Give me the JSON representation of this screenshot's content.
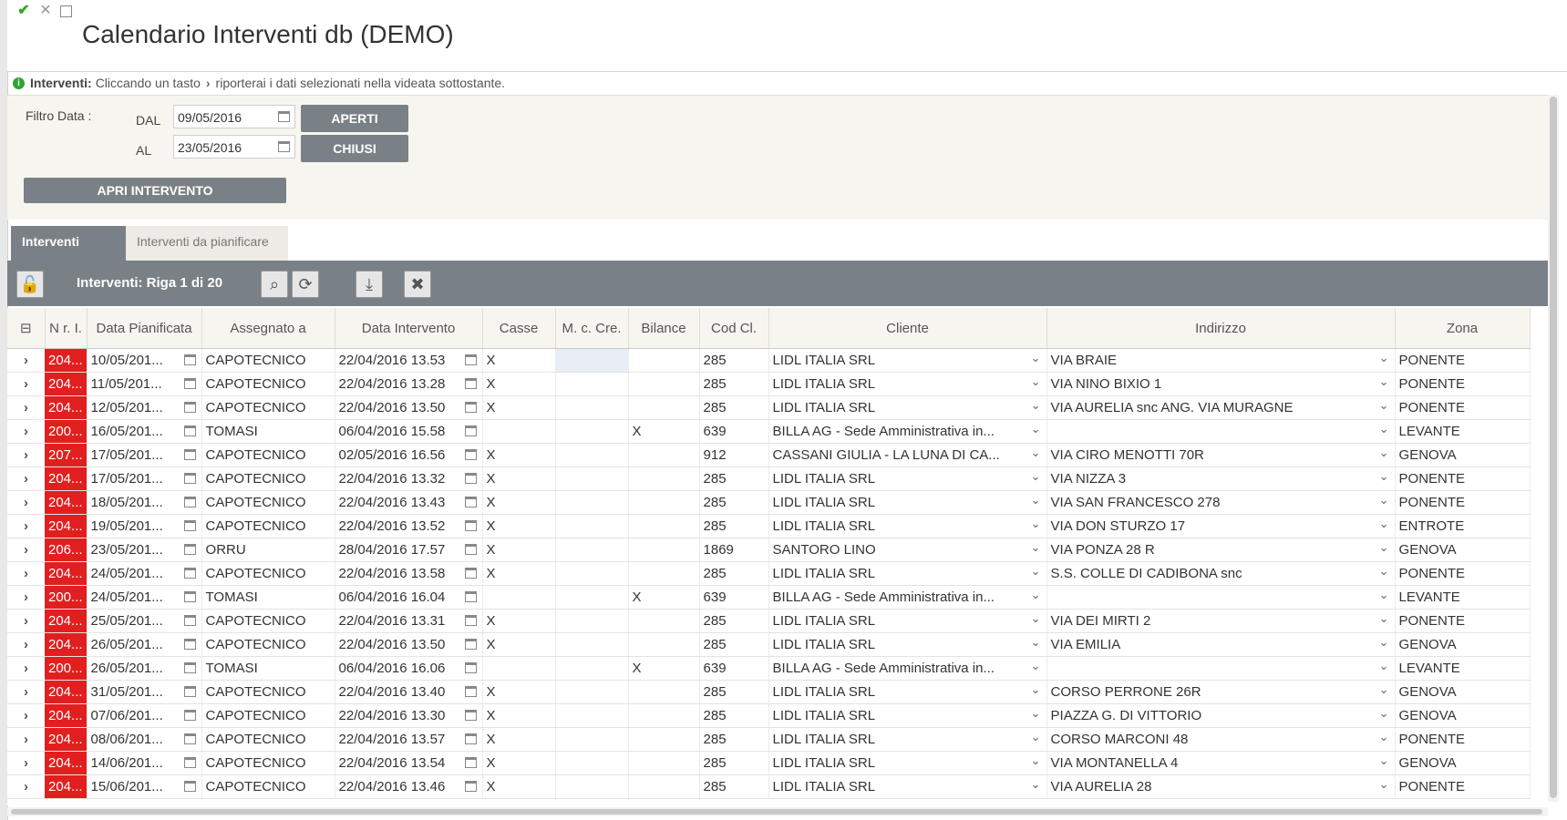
{
  "window": {
    "title": "Calendario Interventi db (DEMO)"
  },
  "info": {
    "label": "Interventi:",
    "text_before": "Cliccando un tasto",
    "text_after": "riporterai i dati selezionati nella videata sottostante."
  },
  "filter": {
    "label": "Filtro Data :",
    "from_label": "DAL",
    "from_value": "09/05/2016",
    "to_label": "AL",
    "to_value": "23/05/2016",
    "open_button": "APERTI",
    "closed_button": "CHIUSI",
    "open_intervention_button": "APRI INTERVENTO"
  },
  "tabs": [
    {
      "label": "Interventi",
      "active": true
    },
    {
      "label": "Interventi da pianificare",
      "active": false
    }
  ],
  "toolbar": {
    "caption": "Interventi: Riga 1 di 20"
  },
  "columns": {
    "nr": "N r. I.",
    "data_pianificata": "Data Pianificata",
    "assegnato": "Assegnato a",
    "data_intervento": "Data Intervento",
    "casse": "Casse",
    "mcre": "M. c. Cre.",
    "bilance": "Bilance",
    "codcl": "Cod Cl.",
    "cliente": "Cliente",
    "indirizzo": "Indirizzo",
    "zona": "Zona"
  },
  "rows": [
    {
      "nr": "204...",
      "data_pianificata": "10/05/201...",
      "assegnato": "CAPOTECNICO",
      "data_intervento": "22/04/2016 13.53",
      "casse": "X",
      "bilance": "",
      "codcl": "285",
      "cliente": "LIDL ITALIA SRL",
      "indirizzo": "VIA BRAIE",
      "zona": "PONENTE"
    },
    {
      "nr": "204...",
      "data_pianificata": "11/05/201...",
      "assegnato": "CAPOTECNICO",
      "data_intervento": "22/04/2016 13.28",
      "casse": "X",
      "bilance": "",
      "codcl": "285",
      "cliente": "LIDL ITALIA SRL",
      "indirizzo": "VIA NINO BIXIO 1",
      "zona": "PONENTE"
    },
    {
      "nr": "204...",
      "data_pianificata": "12/05/201...",
      "assegnato": "CAPOTECNICO",
      "data_intervento": "22/04/2016 13.50",
      "casse": "X",
      "bilance": "",
      "codcl": "285",
      "cliente": "LIDL ITALIA SRL",
      "indirizzo": "VIA AURELIA snc ANG. VIA MURAGNE",
      "zona": "PONENTE"
    },
    {
      "nr": "200...",
      "data_pianificata": "16/05/201...",
      "assegnato": "TOMASI",
      "data_intervento": "06/04/2016 15.58",
      "casse": "",
      "bilance": "X",
      "codcl": "639",
      "cliente": "BILLA AG - Sede Amministrativa in...",
      "indirizzo": "",
      "zona": "LEVANTE"
    },
    {
      "nr": "207...",
      "data_pianificata": "17/05/201...",
      "assegnato": "CAPOTECNICO",
      "data_intervento": "02/05/2016 16.56",
      "casse": "X",
      "bilance": "",
      "codcl": "912",
      "cliente": "CASSANI GIULIA - LA LUNA DI CA...",
      "indirizzo": "VIA CIRO MENOTTI 70R",
      "zona": "GENOVA"
    },
    {
      "nr": "204...",
      "data_pianificata": "17/05/201...",
      "assegnato": "CAPOTECNICO",
      "data_intervento": "22/04/2016 13.32",
      "casse": "X",
      "bilance": "",
      "codcl": "285",
      "cliente": "LIDL ITALIA SRL",
      "indirizzo": "VIA NIZZA 3",
      "zona": "PONENTE"
    },
    {
      "nr": "204...",
      "data_pianificata": "18/05/201...",
      "assegnato": "CAPOTECNICO",
      "data_intervento": "22/04/2016 13.43",
      "casse": "X",
      "bilance": "",
      "codcl": "285",
      "cliente": "LIDL ITALIA SRL",
      "indirizzo": "VIA SAN FRANCESCO 278",
      "zona": "PONENTE"
    },
    {
      "nr": "204...",
      "data_pianificata": "19/05/201...",
      "assegnato": "CAPOTECNICO",
      "data_intervento": "22/04/2016 13.52",
      "casse": "X",
      "bilance": "",
      "codcl": "285",
      "cliente": "LIDL ITALIA SRL",
      "indirizzo": "VIA DON STURZO 17",
      "zona": "ENTROTE"
    },
    {
      "nr": "206...",
      "data_pianificata": "23/05/201...",
      "assegnato": "ORRU",
      "data_intervento": "28/04/2016 17.57",
      "casse": "X",
      "bilance": "",
      "codcl": "1869",
      "cliente": "SANTORO LINO",
      "indirizzo": "VIA PONZA 28 R",
      "zona": "GENOVA"
    },
    {
      "nr": "204...",
      "data_pianificata": "24/05/201...",
      "assegnato": "CAPOTECNICO",
      "data_intervento": "22/04/2016 13.58",
      "casse": "X",
      "bilance": "",
      "codcl": "285",
      "cliente": "LIDL ITALIA SRL",
      "indirizzo": "S.S. COLLE DI CADIBONA snc",
      "zona": "PONENTE"
    },
    {
      "nr": "200...",
      "data_pianificata": "24/05/201...",
      "assegnato": "TOMASI",
      "data_intervento": "06/04/2016 16.04",
      "casse": "",
      "bilance": "X",
      "codcl": "639",
      "cliente": "BILLA AG - Sede Amministrativa in...",
      "indirizzo": "",
      "zona": "LEVANTE"
    },
    {
      "nr": "204...",
      "data_pianificata": "25/05/201...",
      "assegnato": "CAPOTECNICO",
      "data_intervento": "22/04/2016 13.31",
      "casse": "X",
      "bilance": "",
      "codcl": "285",
      "cliente": "LIDL ITALIA SRL",
      "indirizzo": "VIA DEI MIRTI 2",
      "zona": "PONENTE"
    },
    {
      "nr": "204...",
      "data_pianificata": "26/05/201...",
      "assegnato": "CAPOTECNICO",
      "data_intervento": "22/04/2016 13.50",
      "casse": "X",
      "bilance": "",
      "codcl": "285",
      "cliente": "LIDL ITALIA SRL",
      "indirizzo": "VIA EMILIA",
      "zona": "GENOVA"
    },
    {
      "nr": "200...",
      "data_pianificata": "26/05/201...",
      "assegnato": "TOMASI",
      "data_intervento": "06/04/2016 16.06",
      "casse": "",
      "bilance": "X",
      "codcl": "639",
      "cliente": "BILLA AG - Sede Amministrativa in...",
      "indirizzo": "",
      "zona": "LEVANTE"
    },
    {
      "nr": "204...",
      "data_pianificata": "31/05/201...",
      "assegnato": "CAPOTECNICO",
      "data_intervento": "22/04/2016 13.40",
      "casse": "X",
      "bilance": "",
      "codcl": "285",
      "cliente": "LIDL ITALIA SRL",
      "indirizzo": "CORSO PERRONE 26R",
      "zona": "GENOVA"
    },
    {
      "nr": "204...",
      "data_pianificata": "07/06/201...",
      "assegnato": "CAPOTECNICO",
      "data_intervento": "22/04/2016 13.30",
      "casse": "X",
      "bilance": "",
      "codcl": "285",
      "cliente": "LIDL ITALIA SRL",
      "indirizzo": "PIAZZA G. DI VITTORIO",
      "zona": "GENOVA"
    },
    {
      "nr": "204...",
      "data_pianificata": "08/06/201...",
      "assegnato": "CAPOTECNICO",
      "data_intervento": "22/04/2016 13.57",
      "casse": "X",
      "bilance": "",
      "codcl": "285",
      "cliente": "LIDL ITALIA SRL",
      "indirizzo": "CORSO MARCONI 48",
      "zona": "PONENTE"
    },
    {
      "nr": "204...",
      "data_pianificata": "14/06/201...",
      "assegnato": "CAPOTECNICO",
      "data_intervento": "22/04/2016 13.54",
      "casse": "X",
      "bilance": "",
      "codcl": "285",
      "cliente": "LIDL ITALIA SRL",
      "indirizzo": "VIA MONTANELLA 4",
      "zona": "GENOVA"
    },
    {
      "nr": "204...",
      "data_pianificata": "15/06/201...",
      "assegnato": "CAPOTECNICO",
      "data_intervento": "22/04/2016 13.46",
      "casse": "X",
      "bilance": "",
      "codcl": "285",
      "cliente": "LIDL ITALIA SRL",
      "indirizzo": "VIA AURELIA 28",
      "zona": "PONENTE"
    }
  ],
  "colors": {
    "toolbar": "#7a8186",
    "nr_cell": "#e21f1f",
    "panel": "#f7f5ef",
    "ok_green": "#2fa52f"
  }
}
